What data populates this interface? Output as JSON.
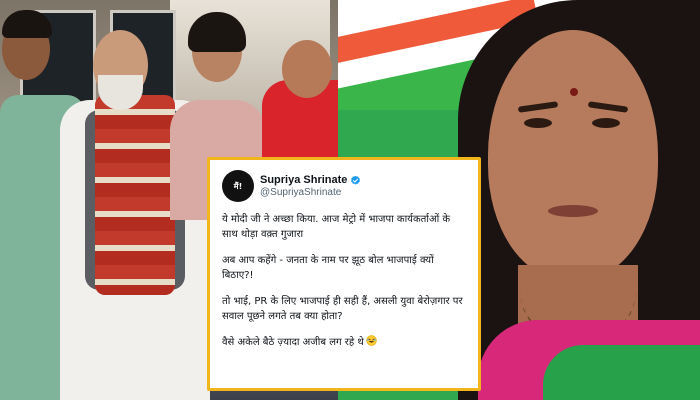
{
  "tweet": {
    "avatar_text": "मैं!",
    "display_name": "Supriya Shrinate",
    "handle": "@SupriyaShrinate",
    "paragraphs": [
      "ये मोदी जी ने अच्छा किया. आज मेट्रो में भाजपा कार्यकर्ताओं के साथ थोड़ा वक़्त गुजारा",
      "अब आप कहेंगे - जनता के नाम पर झूठ बोल भाजपाई क्यों बिठाए?!",
      "तो भाई, PR के लिए भाजपाई ही सही हैं, असली युवा बेरोज़गार पर सवाल पूछने लगते तब क्या होता?",
      "वैसे अकेले बैठे ज़्यादा अजीब लग रहे थे"
    ],
    "emoji": "rolling-on-floor-laughing",
    "border_color": "#f2b51b",
    "verified_color": "#1d9bf0"
  }
}
